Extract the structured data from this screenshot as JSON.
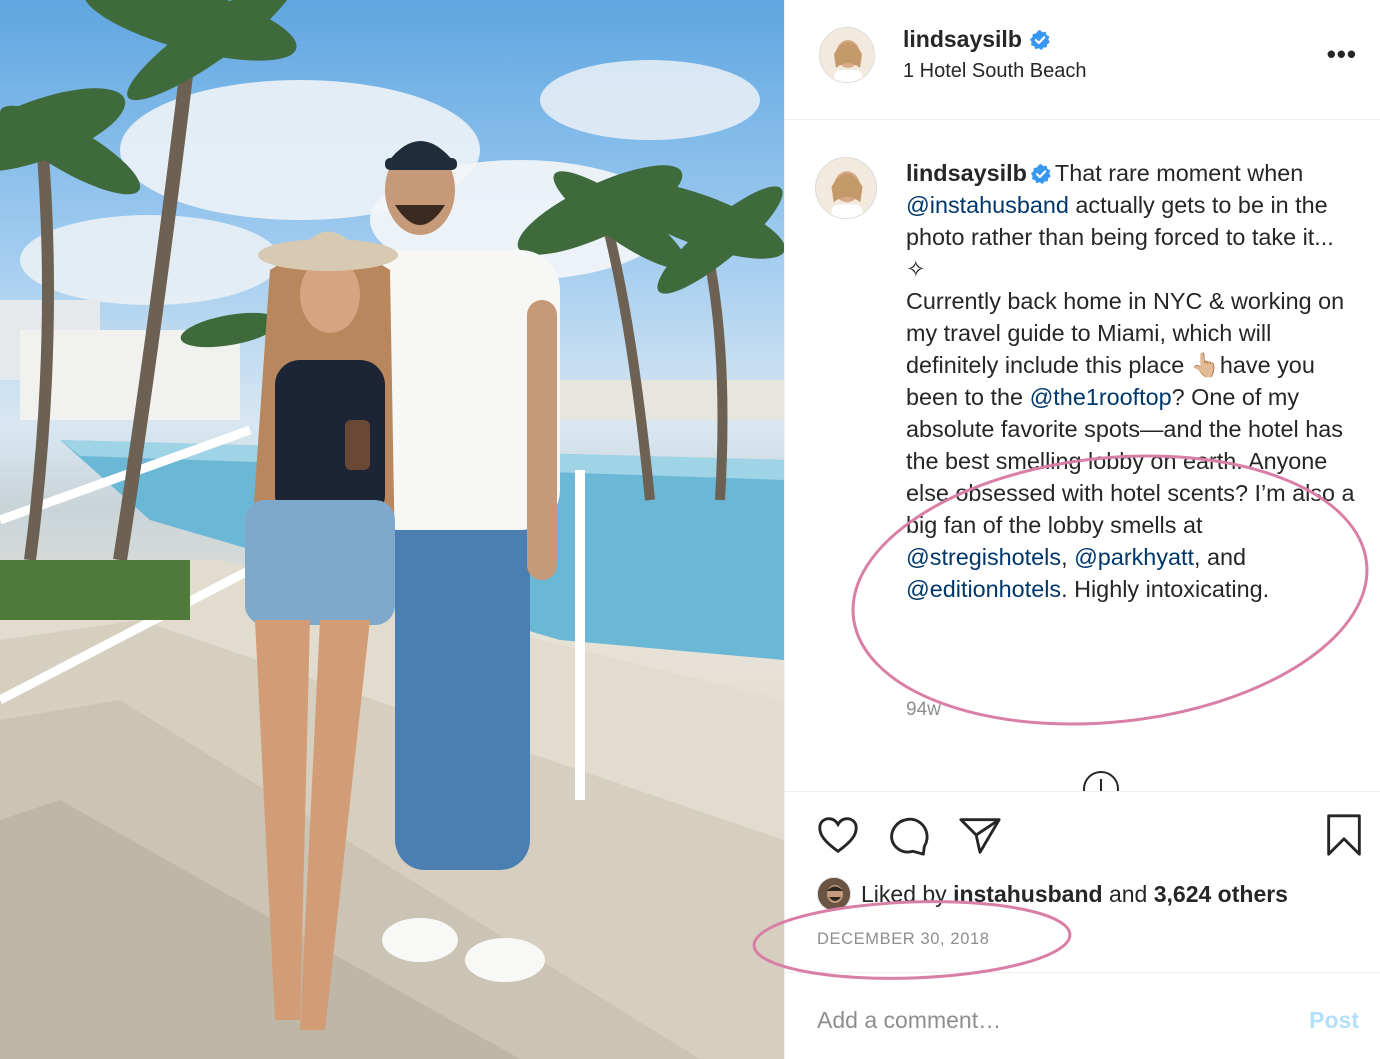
{
  "header": {
    "username": "lindsaysilb",
    "location": "1 Hotel South Beach",
    "more_icon": "more-options-icon",
    "more_glyph": "•••"
  },
  "caption": {
    "username": "lindsaysilb",
    "text_1": "That rare moment when",
    "mention_1": "@instahusband",
    "text_2": " actually gets to be in the photo rather than being forced to take it...",
    "sparkle": "✧",
    "text_3": "Currently back home in NYC & working on my travel guide to Miami, which will definitely include this place ",
    "emoji": "👆🏼",
    "text_4": "have you been to the ",
    "mention_2": "@the1rooftop",
    "text_5": "? One of my absolute favorite spots—and the hotel has the best smelling lobby on earth. Anyone else obsessed with hotel scents? I’m also a big fan of the lobby smells at ",
    "mention_3": "@stregishotels",
    "text_6": ", ",
    "mention_4": "@parkhyatt",
    "text_7": ", and ",
    "mention_5": "@editionhotels",
    "text_8": ". Highly intoxicating.",
    "time_ago": "94w"
  },
  "actions": {
    "liked_by_prefix": "Liked by ",
    "liked_by_user": "instahusband",
    "liked_by_and": " and ",
    "liked_by_others": "3,624 others",
    "date": "DECEMBER 30, 2018"
  },
  "comment": {
    "placeholder": "Add a comment…",
    "post_label": "Post"
  },
  "colors": {
    "mention": "#00376b",
    "verified": "#3897f0",
    "annotation": "#d97fa6",
    "post_button_disabled": "#b2dffc"
  }
}
